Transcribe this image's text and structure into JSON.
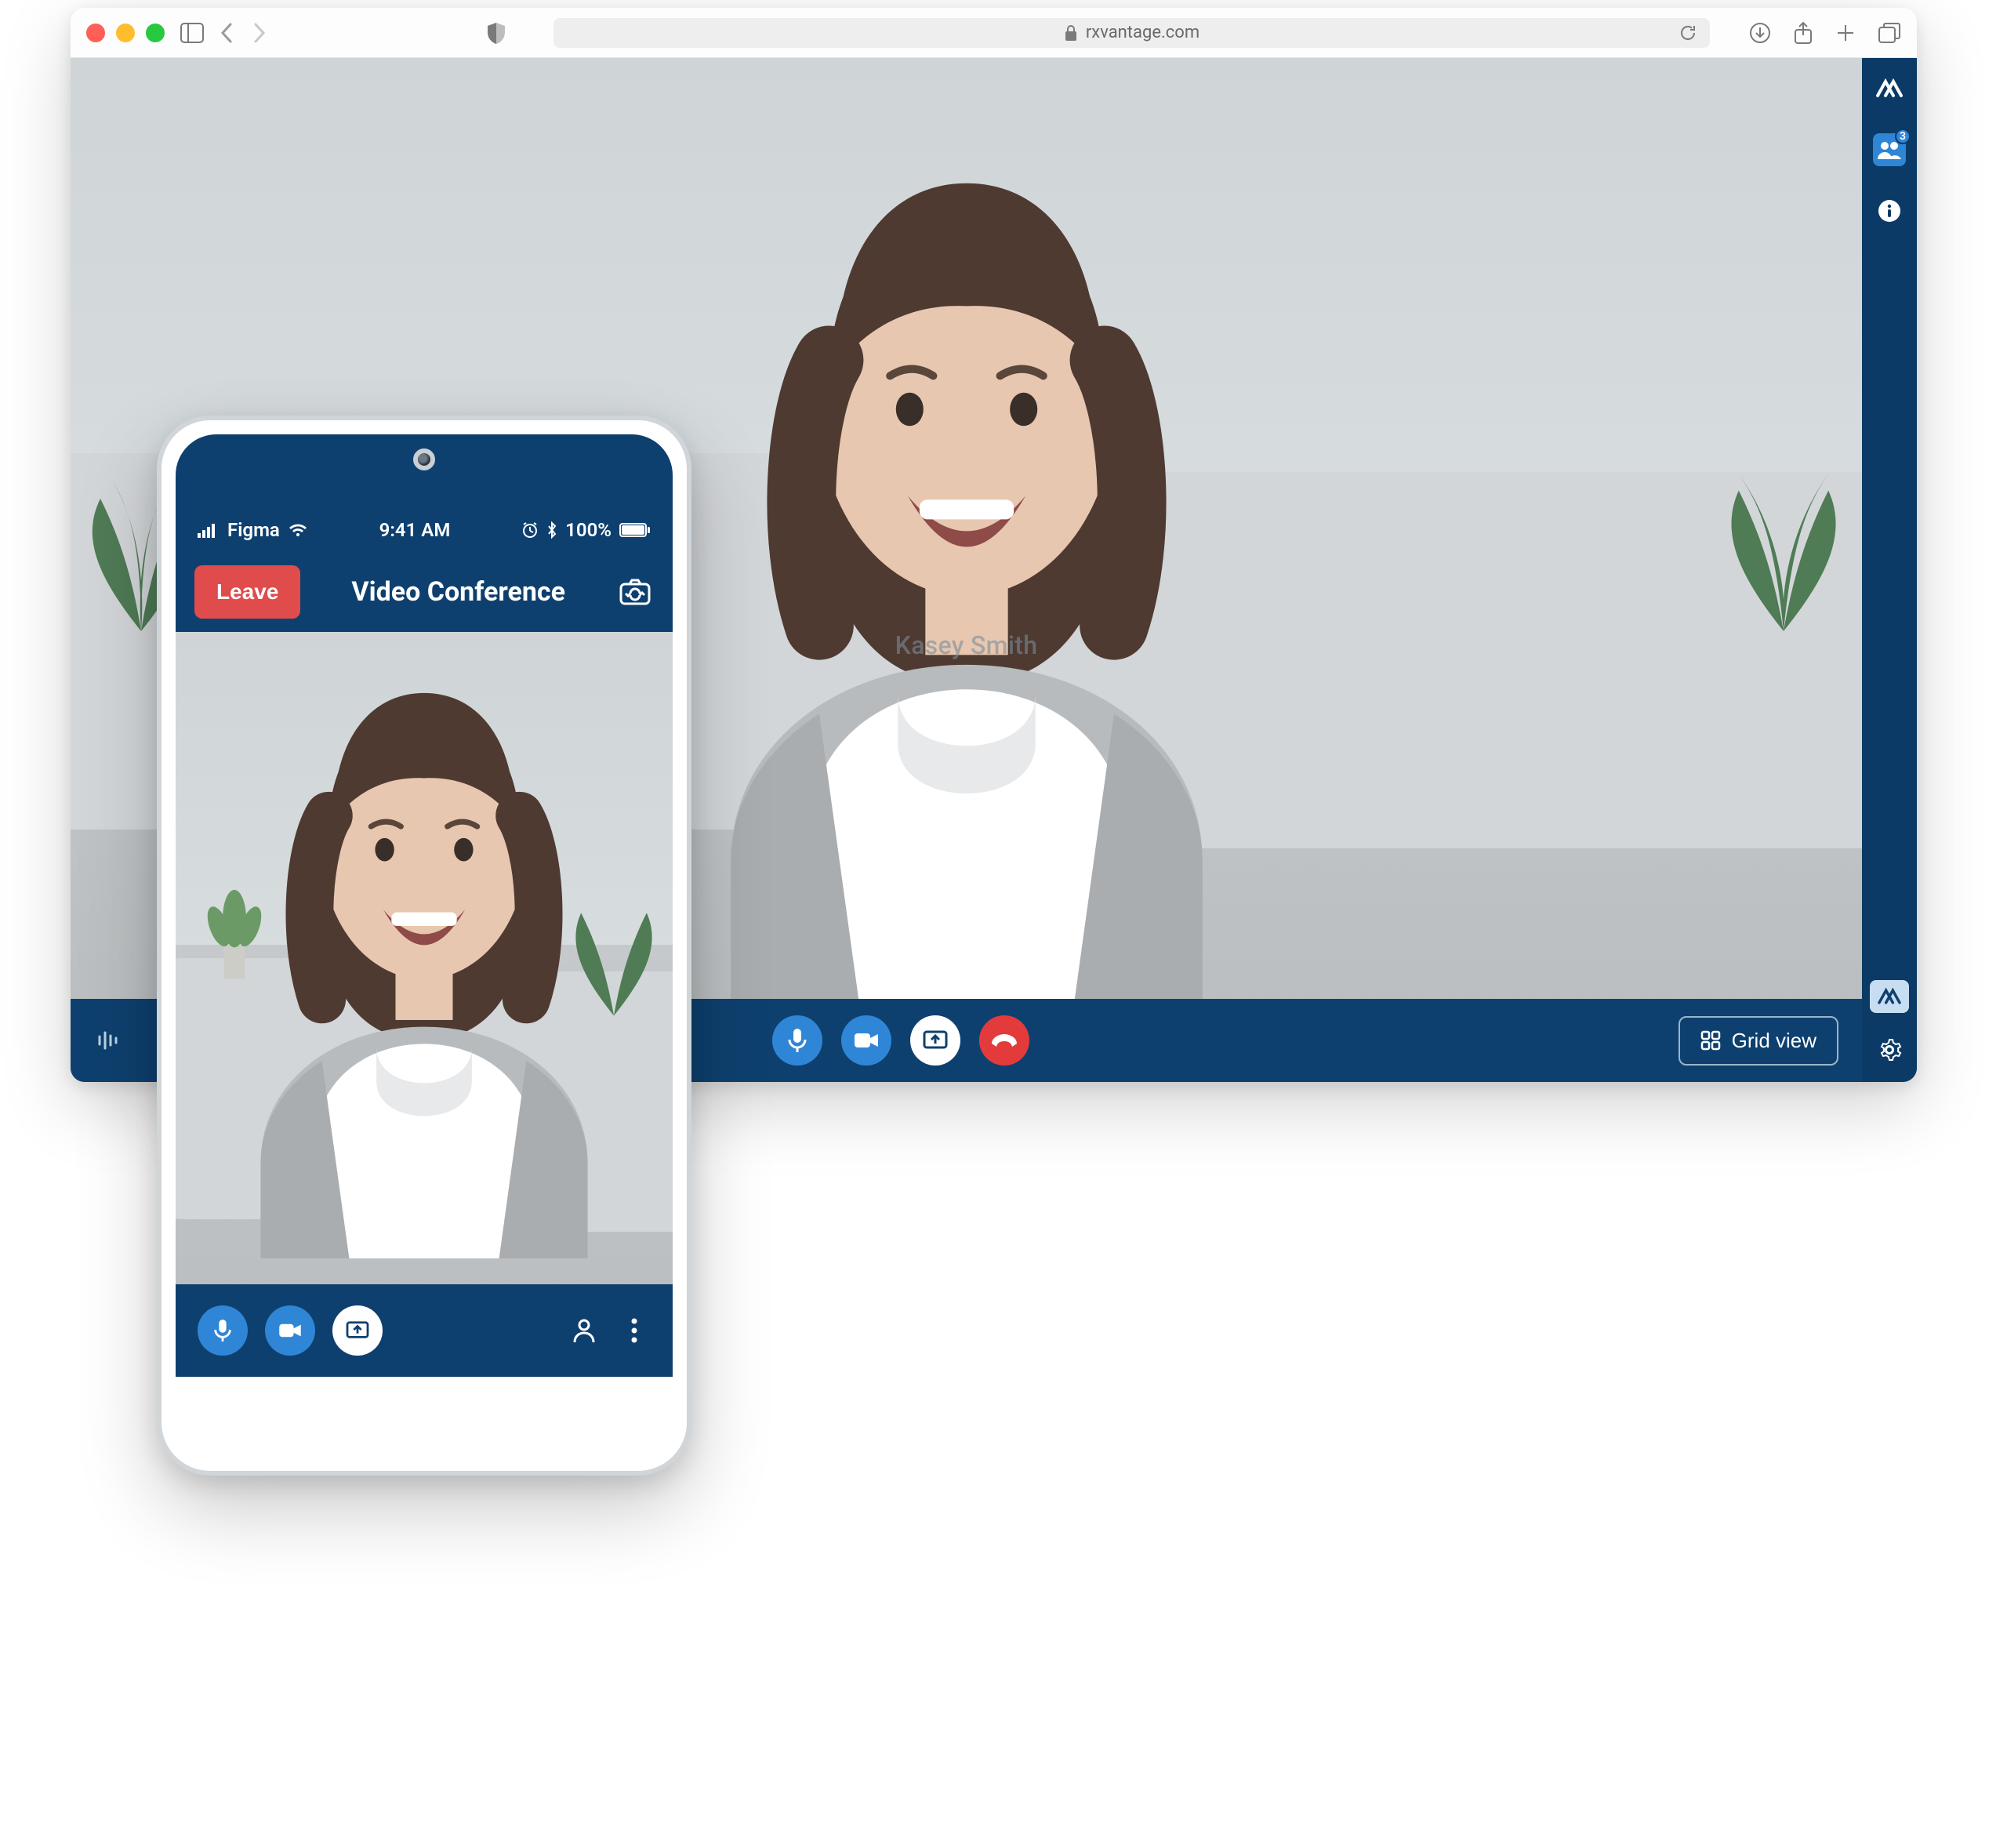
{
  "browser": {
    "url_label": "rxvantage.com"
  },
  "desktop": {
    "participant_name": "Kasey Smith",
    "participants_count": "3",
    "grid_view_label": "Grid view"
  },
  "phone": {
    "statusbar": {
      "carrier": "Figma",
      "time": "9:41 AM",
      "battery": "100%"
    },
    "header": {
      "leave_label": "Leave",
      "title": "Video Conference"
    }
  },
  "colors": {
    "brand_navy": "#0e406f",
    "action_blue": "#2f86d6",
    "danger_red": "#e04b4b"
  }
}
